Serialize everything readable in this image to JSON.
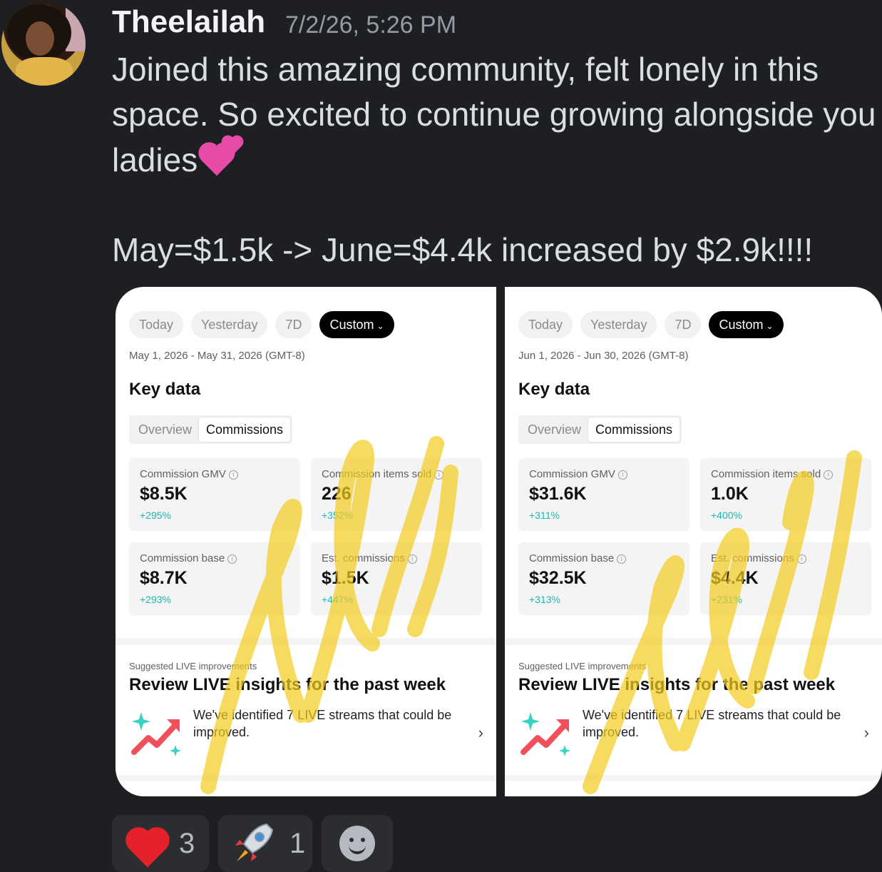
{
  "message": {
    "username": "Theelailah",
    "timestamp": "7/2/26, 5:26 PM",
    "text_line1": "Joined this amazing community, felt lonely in this",
    "text_line2": "space. So excited to continue growing alongside you",
    "text_line3": "ladies",
    "emoji": "two-hearts",
    "text_line5": "May=$1.5k  -> June=$4.4k  increased by $2.9k!!!!"
  },
  "left_panel": {
    "pills": [
      "Today",
      "Yesterday",
      "7D",
      "Custom"
    ],
    "date_range": "May 1, 2026 - May 31, 2026 (GMT-8)",
    "key_data_title": "Key data",
    "segments": [
      "Overview",
      "Commissions"
    ],
    "cards": [
      {
        "label": "Commission GMV",
        "value": "$8.5K",
        "delta": "+295%"
      },
      {
        "label": "Commission items sold",
        "value": "226",
        "delta": "+352%"
      },
      {
        "label": "Commission base",
        "value": "$8.7K",
        "delta": "+293%"
      },
      {
        "label": "Est. commissions",
        "value": "$1.5K",
        "delta": "+447%"
      }
    ],
    "suggested_label": "Suggested LIVE improvements",
    "suggested_title": "Review LIVE insights for the past week",
    "suggested_body": "We've identified 7 LIVE streams that could be improved."
  },
  "right_panel": {
    "pills": [
      "Today",
      "Yesterday",
      "7D",
      "Custom"
    ],
    "date_range": "Jun 1, 2026 - Jun 30, 2026 (GMT-8)",
    "key_data_title": "Key data",
    "segments": [
      "Overview",
      "Commissions"
    ],
    "cards": [
      {
        "label": "Commission GMV",
        "value": "$31.6K",
        "delta": "+311%"
      },
      {
        "label": "Commission items sold",
        "value": "1.0K",
        "delta": "+400%"
      },
      {
        "label": "Commission base",
        "value": "$32.5K",
        "delta": "+313%"
      },
      {
        "label": "Est. commissions",
        "value": "$4.4K",
        "delta": "+231%"
      }
    ],
    "suggested_label": "Suggested LIVE improvements",
    "suggested_title": "Review LIVE insights for the past week",
    "suggested_body": "We've identified 7 LIVE streams that could be improved."
  },
  "reactions": [
    {
      "emoji": "red-heart",
      "count": "3"
    },
    {
      "emoji": "rocket",
      "count": "1"
    },
    {
      "emoji": "add-reaction"
    }
  ],
  "colors": {
    "background": "#1e1f22",
    "delta_teal": "#1fb7b1",
    "watermark_yellow": "#f5cc1f"
  }
}
